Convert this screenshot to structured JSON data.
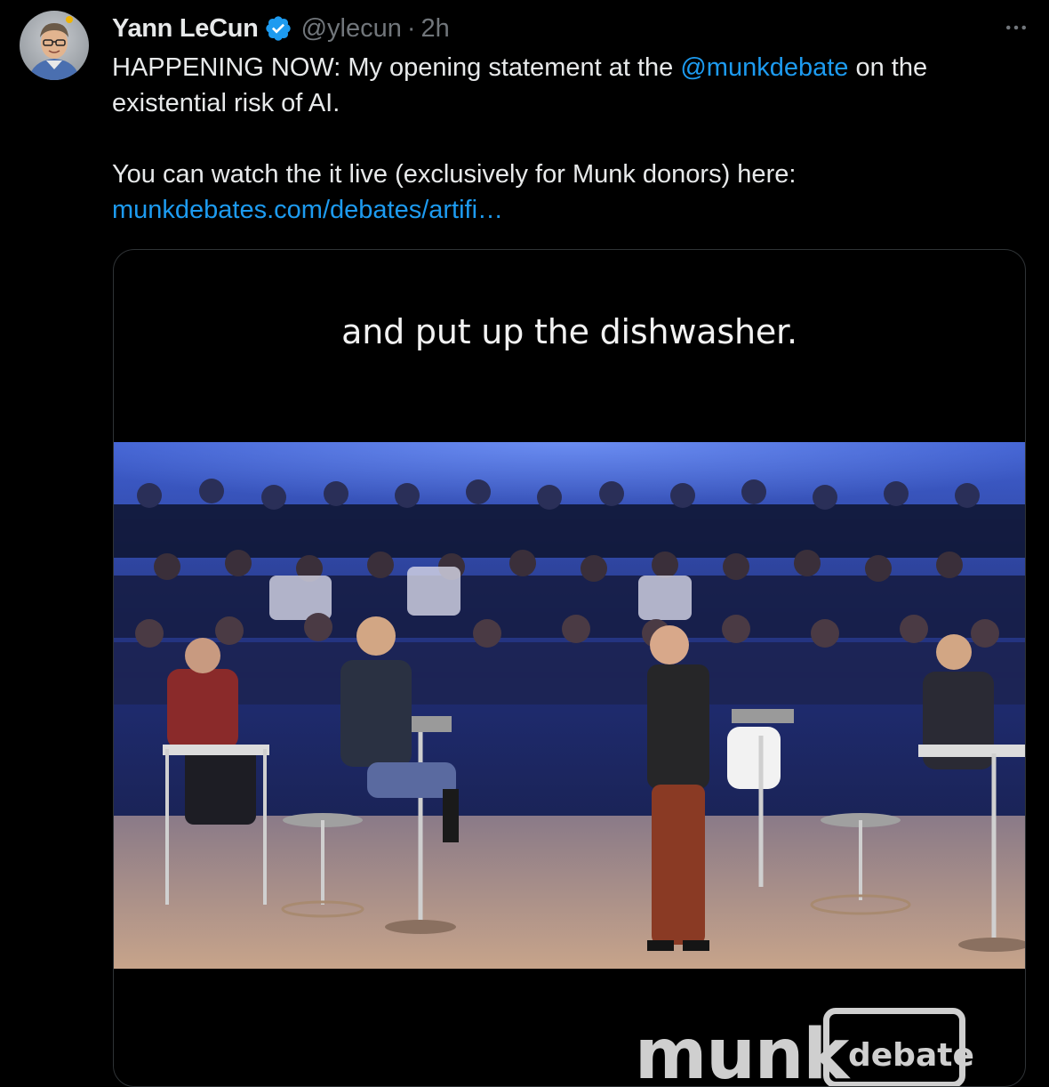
{
  "tweet": {
    "author": {
      "name": "Yann LeCun",
      "handle": "@ylecun",
      "separator": "·",
      "time": "2h",
      "verified_icon": "verified-badge-icon",
      "verified_color": "#1d9bf0"
    },
    "more_icon": "more-horizontal-icon",
    "text": {
      "line1_prefix": "HAPPENING NOW:  My opening statement at the ",
      "mention": "@munkdebate",
      "line1_suffix": " on the",
      "line2": "existential risk of AI.",
      "line3": "You can watch the it live (exclusively for Munk donors) here:",
      "url": "munkdebates.com/debates/artifi…"
    },
    "media": {
      "caption": "and put up the dishwasher.",
      "brand_word": "munk",
      "brand_sub": "debate"
    }
  },
  "colors": {
    "background": "#000000",
    "text": "#e7e9ea",
    "muted": "#71767b",
    "link": "#1d9bf0"
  }
}
